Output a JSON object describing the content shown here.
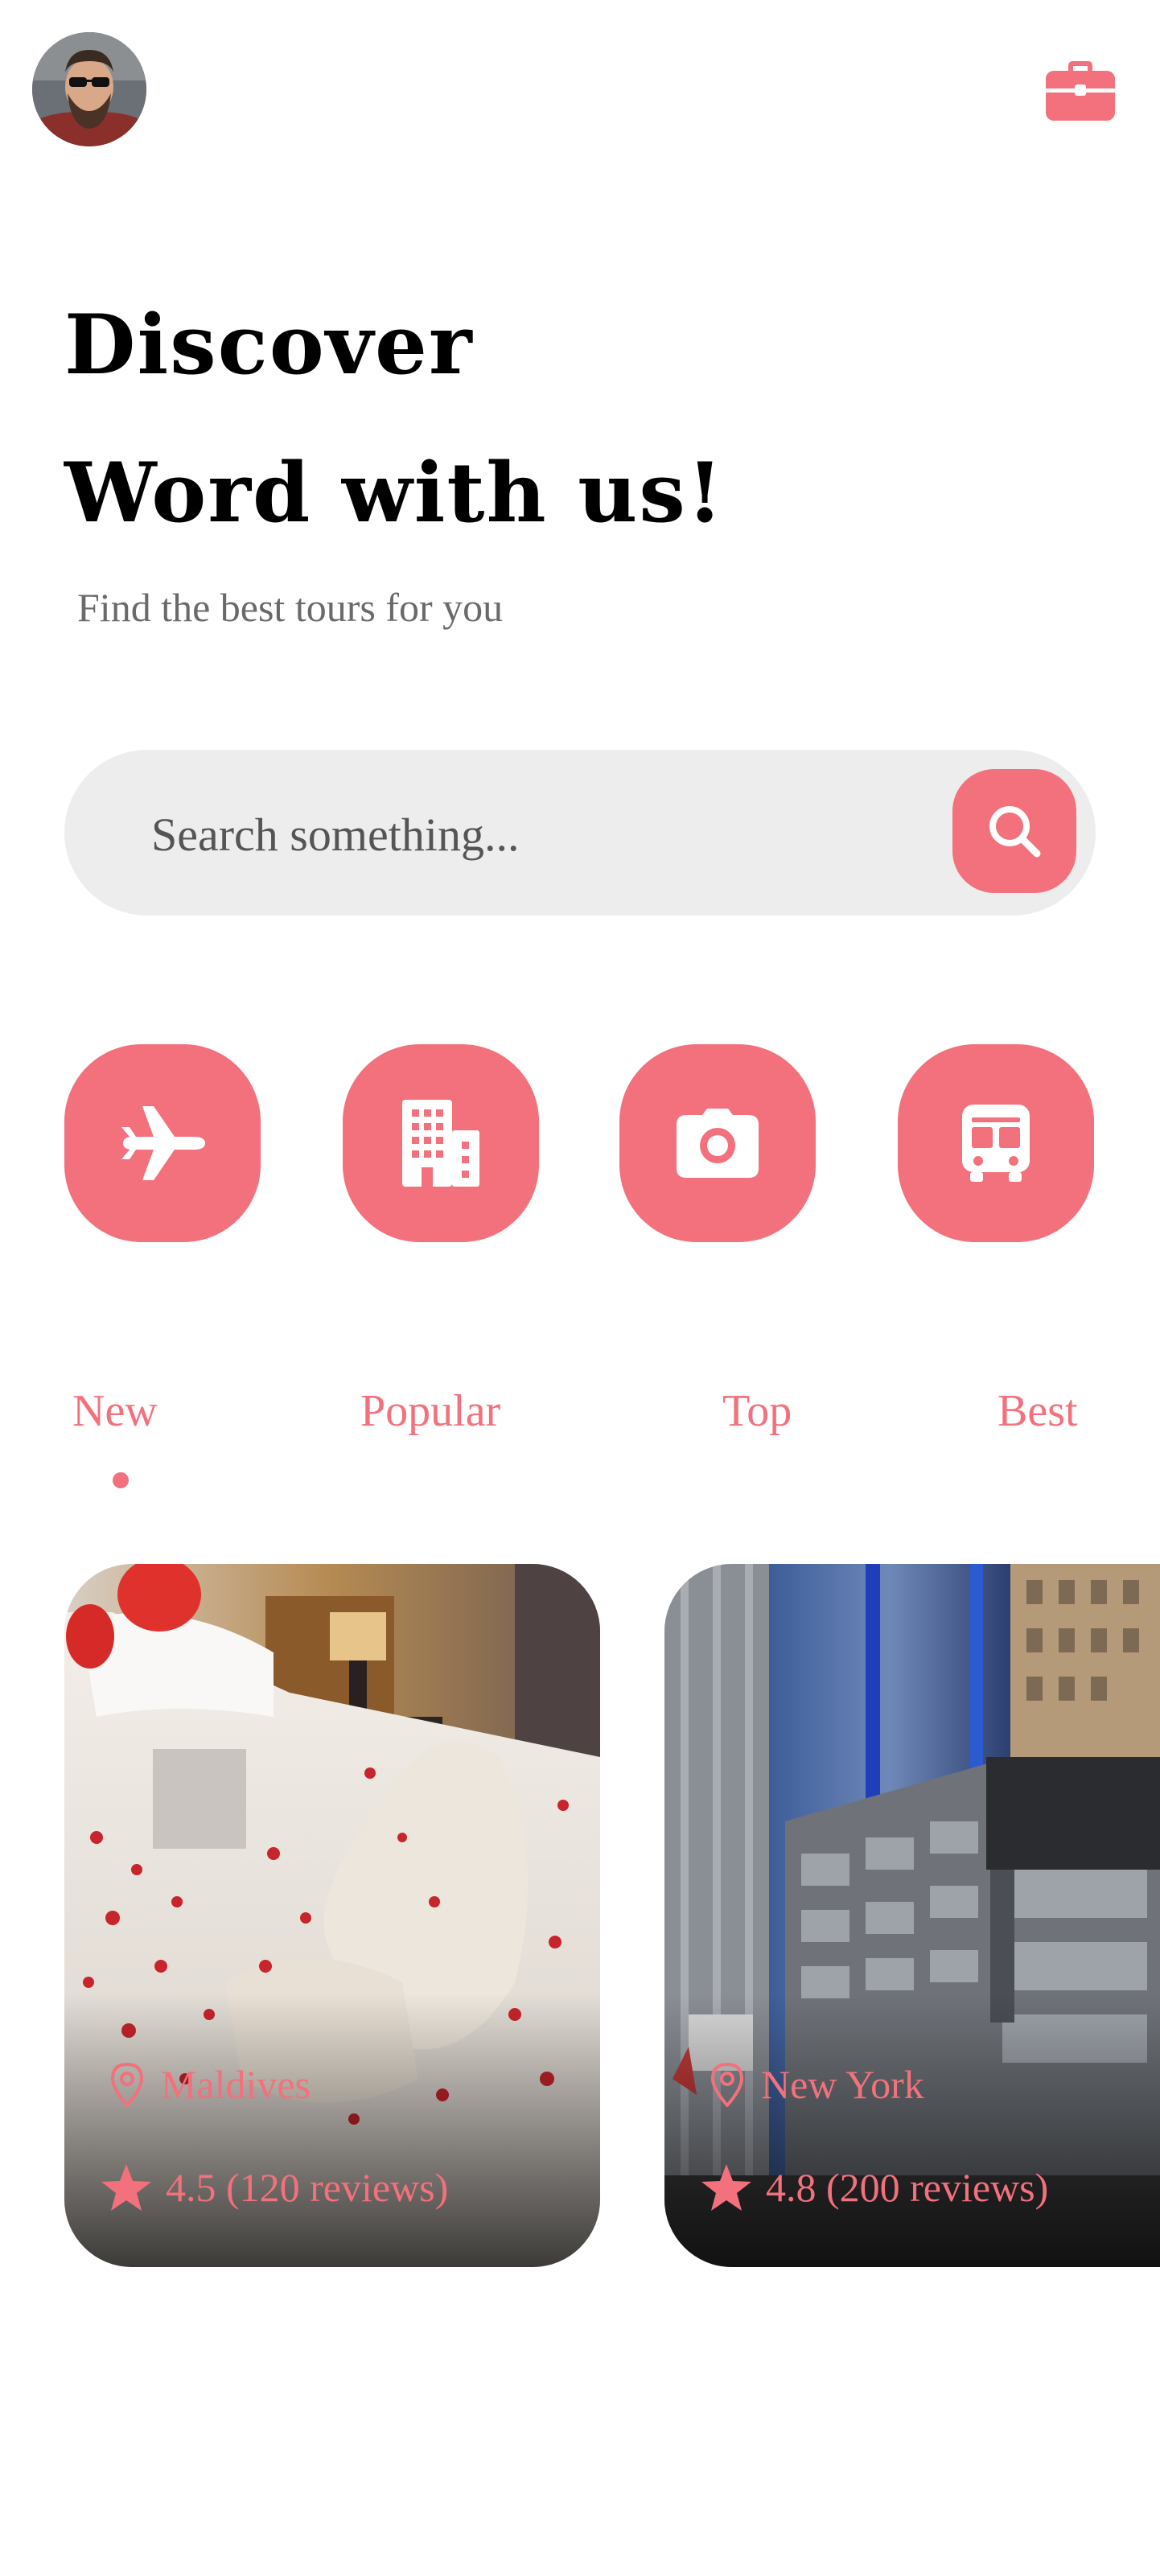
{
  "header": {
    "avatar_icon": "user-avatar",
    "bag_icon": "briefcase-icon",
    "accent_color": "#f2717c"
  },
  "hero": {
    "title_line1": "Discover",
    "title_line2": "Word with us!",
    "subtitle": "Find the best tours for you"
  },
  "search": {
    "placeholder": "Search something...",
    "button_icon": "search-icon"
  },
  "categories": [
    {
      "icon": "airplane-icon"
    },
    {
      "icon": "hotel-building-icon"
    },
    {
      "icon": "camera-icon"
    },
    {
      "icon": "bus-icon"
    }
  ],
  "tabs": [
    {
      "label": "New",
      "active": true
    },
    {
      "label": "Popular",
      "active": false
    },
    {
      "label": "Top",
      "active": false
    },
    {
      "label": "Best",
      "active": false
    }
  ],
  "cards": [
    {
      "location": "Maldives",
      "rating": "4.5 (120 reviews)",
      "image": "hotel-room-bed-rose-petals"
    },
    {
      "location": "New York",
      "rating": "4.8 (200 reviews)",
      "image": "westin-hotel-skyscraper"
    }
  ]
}
